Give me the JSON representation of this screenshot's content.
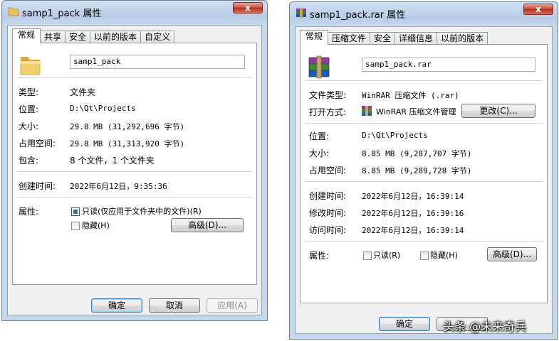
{
  "left_window": {
    "title": "samp1_pack 属性",
    "close_label": "x",
    "tabs": [
      "常规",
      "共享",
      "安全",
      "以前的版本",
      "自定义"
    ],
    "active_tab": "常规",
    "name": "samp1_pack",
    "fields": [
      {
        "label": "类型:",
        "value": "文件夹"
      },
      {
        "label": "位置:",
        "value": "D:\\Qt\\Projects"
      },
      {
        "label": "大小:",
        "value": "29.8 MB (31,292,696 字节)"
      },
      {
        "label": "占用空间:",
        "value": "29.8 MB (31,313,920 字节)"
      },
      {
        "label": "包含:",
        "value": "8 个文件，1 个文件夹"
      }
    ],
    "created_label": "创建时间:",
    "created_value": "2022年6月12日，9:35:36",
    "attributes_label": "属性:",
    "readonly_label": "只读(仅应用于文件夹中的文件)(R)",
    "readonly_checked": true,
    "hidden_label": "隐藏(H)",
    "hidden_checked": false,
    "advanced_button": "高级(D)...",
    "ok_button": "确定",
    "cancel_button": "取消",
    "apply_button": "应用(A)"
  },
  "right_window": {
    "title": "samp1_pack.rar 属性",
    "close_label": "x",
    "tabs": [
      "常规",
      "压缩文件",
      "安全",
      "详细信息",
      "以前的版本"
    ],
    "active_tab": "常规",
    "name": "samp1_pack.rar",
    "filetype_label": "文件类型:",
    "filetype_value": "WinRAR 压缩文件 (.rar)",
    "openwith_label": "打开方式:",
    "openwith_value": "WinRAR 压缩文件管理",
    "change_button": "更改(C)...",
    "fields": [
      {
        "label": "位置:",
        "value": "D:\\Qt\\Projects"
      },
      {
        "label": "大小:",
        "value": "8.85 MB (9,287,707 字节)"
      },
      {
        "label": "占用空间:",
        "value": "8.85 MB (9,289,728 字节)"
      }
    ],
    "times": [
      {
        "label": "创建时间:",
        "value": "2022年6月12日，16:39:14"
      },
      {
        "label": "修改时间:",
        "value": "2022年6月12日，16:39:16"
      },
      {
        "label": "访问时间:",
        "value": "2022年6月12日，16:39:14"
      }
    ],
    "attributes_label": "属性:",
    "readonly_label": "只读(R)",
    "readonly_checked": false,
    "hidden_label": "隐藏(H)",
    "hidden_checked": false,
    "advanced_button": "高级(D)...",
    "ok_button": "确定"
  },
  "watermark": "头条 @未来奇兵",
  "colors": {
    "titlebar": "#c6d8ec",
    "close": "#c9442e",
    "panel": "#ffffff",
    "checkbox_fill": "#2d6db5"
  }
}
